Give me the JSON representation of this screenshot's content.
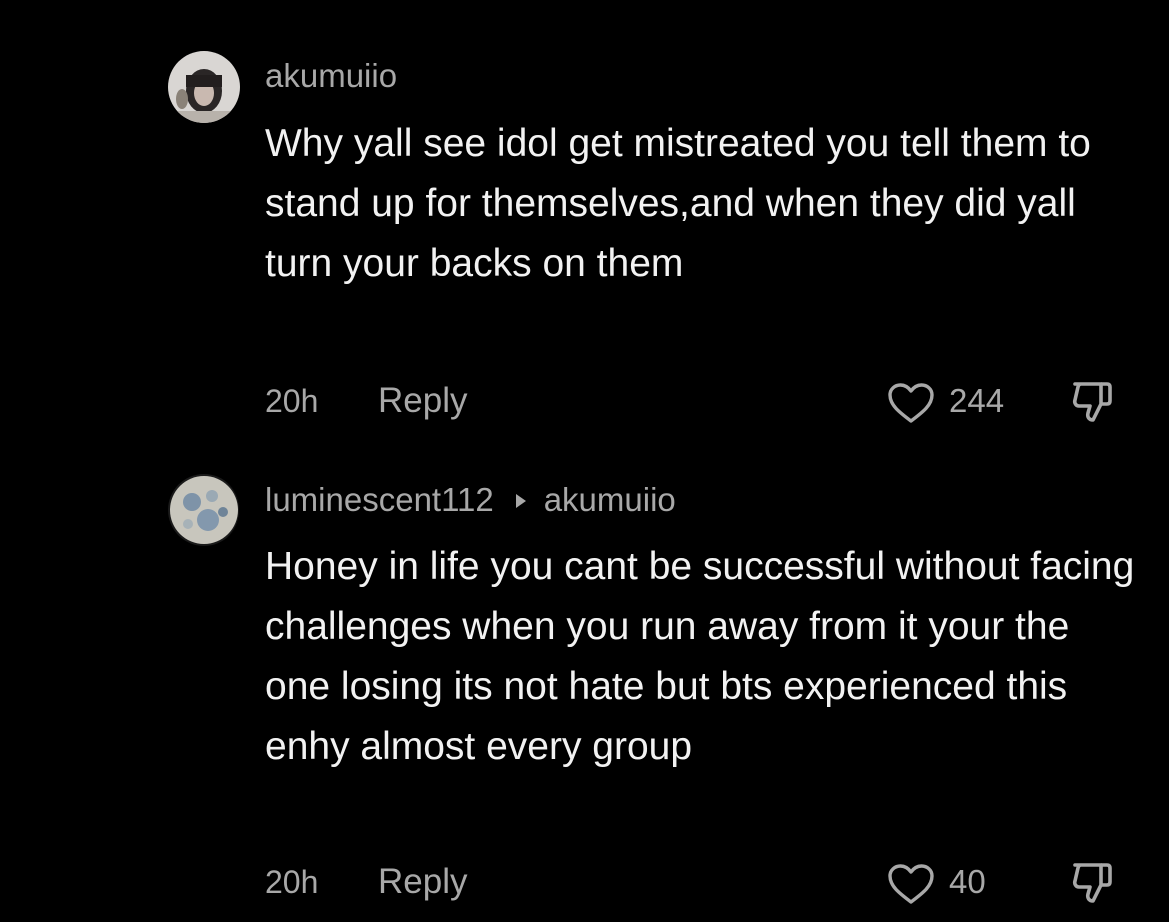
{
  "comments": [
    {
      "username": "akumuiio",
      "reply_to": "",
      "text": "Why yall see idol get mistreated you tell them to stand up for themselves,and when they did yall turn your backs on them",
      "time": "20h",
      "reply_label": "Reply",
      "likes": "244",
      "avatar_icon": "profile-photo-girl-icon",
      "like_icon": "heart-outline-icon",
      "dislike_icon": "thumbs-down-outline-icon"
    },
    {
      "username": "luminescent112",
      "reply_to": "akumuiio",
      "text": "Honey in life you cant be successful without facing challenges when you run away from it your the one losing its not hate but bts experienced this enhy almost every group",
      "time": "20h",
      "reply_label": "Reply",
      "likes": "40",
      "avatar_icon": "profile-photo-moon-icon",
      "like_icon": "heart-outline-icon",
      "dislike_icon": "thumbs-down-outline-icon"
    }
  ],
  "colors": {
    "background": "#000000",
    "primary_text": "#f2f2f2",
    "secondary_text": "#a8a8a8"
  }
}
